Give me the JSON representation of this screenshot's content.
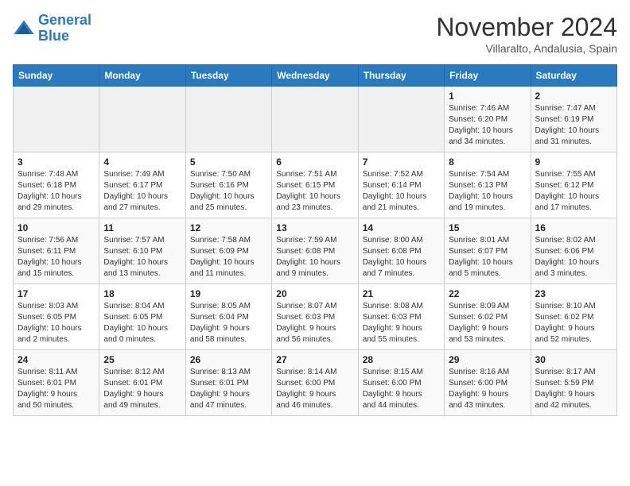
{
  "header": {
    "logo_line1": "General",
    "logo_line2": "Blue",
    "month": "November 2024",
    "location": "Villaralto, Andalusia, Spain"
  },
  "weekdays": [
    "Sunday",
    "Monday",
    "Tuesday",
    "Wednesday",
    "Thursday",
    "Friday",
    "Saturday"
  ],
  "weeks": [
    [
      {
        "day": "",
        "info": ""
      },
      {
        "day": "",
        "info": ""
      },
      {
        "day": "",
        "info": ""
      },
      {
        "day": "",
        "info": ""
      },
      {
        "day": "",
        "info": ""
      },
      {
        "day": "1",
        "info": "Sunrise: 7:46 AM\nSunset: 6:20 PM\nDaylight: 10 hours\nand 34 minutes."
      },
      {
        "day": "2",
        "info": "Sunrise: 7:47 AM\nSunset: 6:19 PM\nDaylight: 10 hours\nand 31 minutes."
      }
    ],
    [
      {
        "day": "3",
        "info": "Sunrise: 7:48 AM\nSunset: 6:18 PM\nDaylight: 10 hours\nand 29 minutes."
      },
      {
        "day": "4",
        "info": "Sunrise: 7:49 AM\nSunset: 6:17 PM\nDaylight: 10 hours\nand 27 minutes."
      },
      {
        "day": "5",
        "info": "Sunrise: 7:50 AM\nSunset: 6:16 PM\nDaylight: 10 hours\nand 25 minutes."
      },
      {
        "day": "6",
        "info": "Sunrise: 7:51 AM\nSunset: 6:15 PM\nDaylight: 10 hours\nand 23 minutes."
      },
      {
        "day": "7",
        "info": "Sunrise: 7:52 AM\nSunset: 6:14 PM\nDaylight: 10 hours\nand 21 minutes."
      },
      {
        "day": "8",
        "info": "Sunrise: 7:54 AM\nSunset: 6:13 PM\nDaylight: 10 hours\nand 19 minutes."
      },
      {
        "day": "9",
        "info": "Sunrise: 7:55 AM\nSunset: 6:12 PM\nDaylight: 10 hours\nand 17 minutes."
      }
    ],
    [
      {
        "day": "10",
        "info": "Sunrise: 7:56 AM\nSunset: 6:11 PM\nDaylight: 10 hours\nand 15 minutes."
      },
      {
        "day": "11",
        "info": "Sunrise: 7:57 AM\nSunset: 6:10 PM\nDaylight: 10 hours\nand 13 minutes."
      },
      {
        "day": "12",
        "info": "Sunrise: 7:58 AM\nSunset: 6:09 PM\nDaylight: 10 hours\nand 11 minutes."
      },
      {
        "day": "13",
        "info": "Sunrise: 7:59 AM\nSunset: 6:08 PM\nDaylight: 10 hours\nand 9 minutes."
      },
      {
        "day": "14",
        "info": "Sunrise: 8:00 AM\nSunset: 6:08 PM\nDaylight: 10 hours\nand 7 minutes."
      },
      {
        "day": "15",
        "info": "Sunrise: 8:01 AM\nSunset: 6:07 PM\nDaylight: 10 hours\nand 5 minutes."
      },
      {
        "day": "16",
        "info": "Sunrise: 8:02 AM\nSunset: 6:06 PM\nDaylight: 10 hours\nand 3 minutes."
      }
    ],
    [
      {
        "day": "17",
        "info": "Sunrise: 8:03 AM\nSunset: 6:05 PM\nDaylight: 10 hours\nand 2 minutes."
      },
      {
        "day": "18",
        "info": "Sunrise: 8:04 AM\nSunset: 6:05 PM\nDaylight: 10 hours\nand 0 minutes."
      },
      {
        "day": "19",
        "info": "Sunrise: 8:05 AM\nSunset: 6:04 PM\nDaylight: 9 hours\nand 58 minutes."
      },
      {
        "day": "20",
        "info": "Sunrise: 8:07 AM\nSunset: 6:03 PM\nDaylight: 9 hours\nand 56 minutes."
      },
      {
        "day": "21",
        "info": "Sunrise: 8:08 AM\nSunset: 6:03 PM\nDaylight: 9 hours\nand 55 minutes."
      },
      {
        "day": "22",
        "info": "Sunrise: 8:09 AM\nSunset: 6:02 PM\nDaylight: 9 hours\nand 53 minutes."
      },
      {
        "day": "23",
        "info": "Sunrise: 8:10 AM\nSunset: 6:02 PM\nDaylight: 9 hours\nand 52 minutes."
      }
    ],
    [
      {
        "day": "24",
        "info": "Sunrise: 8:11 AM\nSunset: 6:01 PM\nDaylight: 9 hours\nand 50 minutes."
      },
      {
        "day": "25",
        "info": "Sunrise: 8:12 AM\nSunset: 6:01 PM\nDaylight: 9 hours\nand 49 minutes."
      },
      {
        "day": "26",
        "info": "Sunrise: 8:13 AM\nSunset: 6:01 PM\nDaylight: 9 hours\nand 47 minutes."
      },
      {
        "day": "27",
        "info": "Sunrise: 8:14 AM\nSunset: 6:00 PM\nDaylight: 9 hours\nand 46 minutes."
      },
      {
        "day": "28",
        "info": "Sunrise: 8:15 AM\nSunset: 6:00 PM\nDaylight: 9 hours\nand 44 minutes."
      },
      {
        "day": "29",
        "info": "Sunrise: 8:16 AM\nSunset: 6:00 PM\nDaylight: 9 hours\nand 43 minutes."
      },
      {
        "day": "30",
        "info": "Sunrise: 8:17 AM\nSunset: 5:59 PM\nDaylight: 9 hours\nand 42 minutes."
      }
    ]
  ]
}
